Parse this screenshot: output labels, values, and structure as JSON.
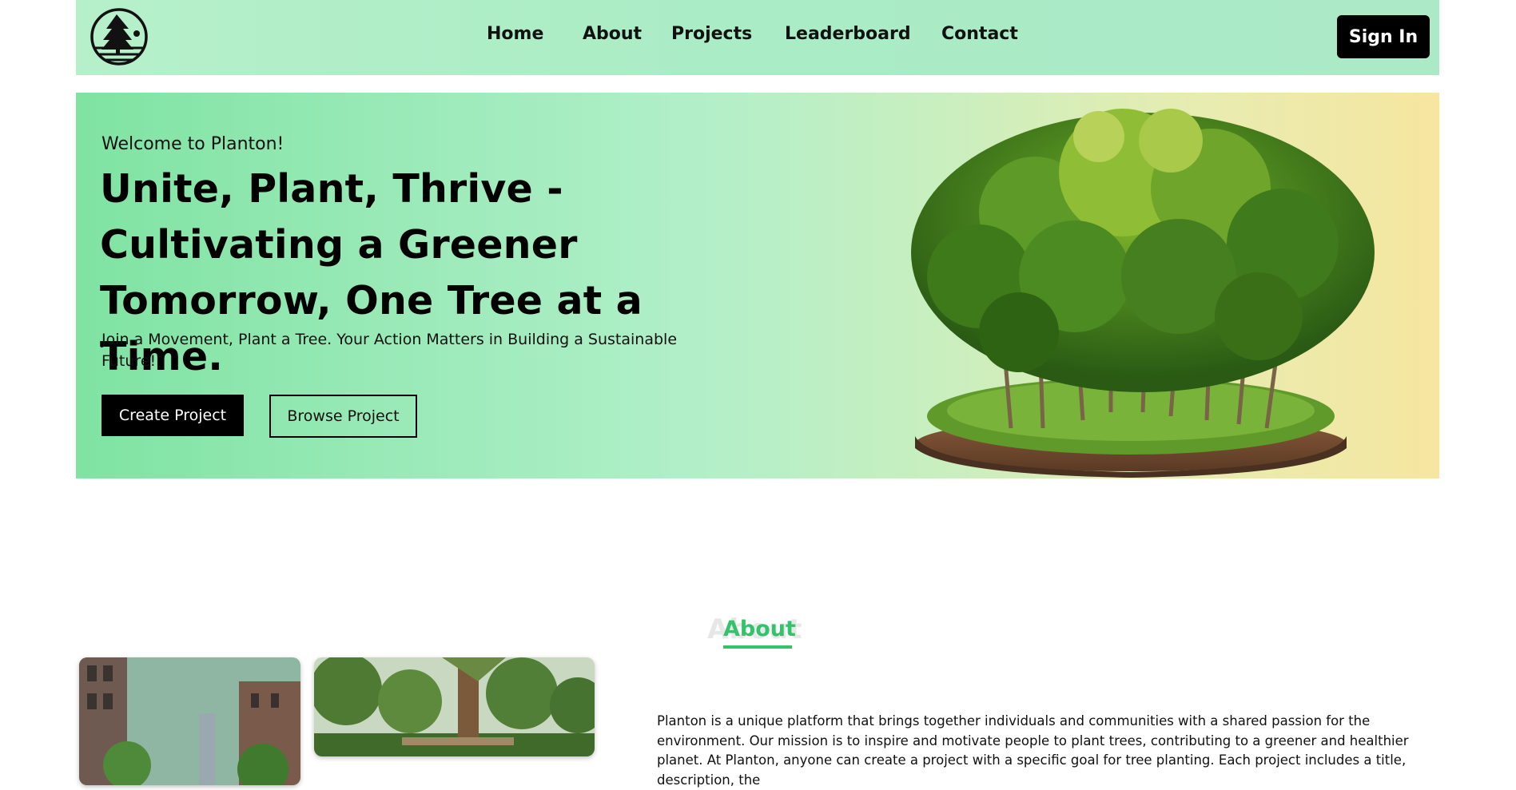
{
  "nav": {
    "links": [
      "Home",
      "About",
      "Projects",
      "Leaderboard",
      "Contact"
    ],
    "signin_label": "Sign In"
  },
  "hero": {
    "welcome": "Welcome to Planton!",
    "title": "Unite, Plant, Thrive - Cultivating a Greener Tomorrow, One Tree at a Time.",
    "subtitle": "Join a Movement, Plant a Tree. Your Action Matters in Building a Sustainable Future!",
    "create_label": "Create Project",
    "browse_label": "Browse Project"
  },
  "about": {
    "ghost_title": "About",
    "title": "About",
    "text": "Planton is a unique platform that brings together individuals and communities with a shared passion for the environment. Our mission is to inspire and motivate people to plant trees, contributing to a greener and healthier planet. At Planton, anyone can create a project with a specific goal for tree planting. Each project includes a title, description, the"
  },
  "colors": {
    "accent_green": "#33c36b",
    "nav_bg": "#b0eec8",
    "button_dark": "#000000"
  }
}
